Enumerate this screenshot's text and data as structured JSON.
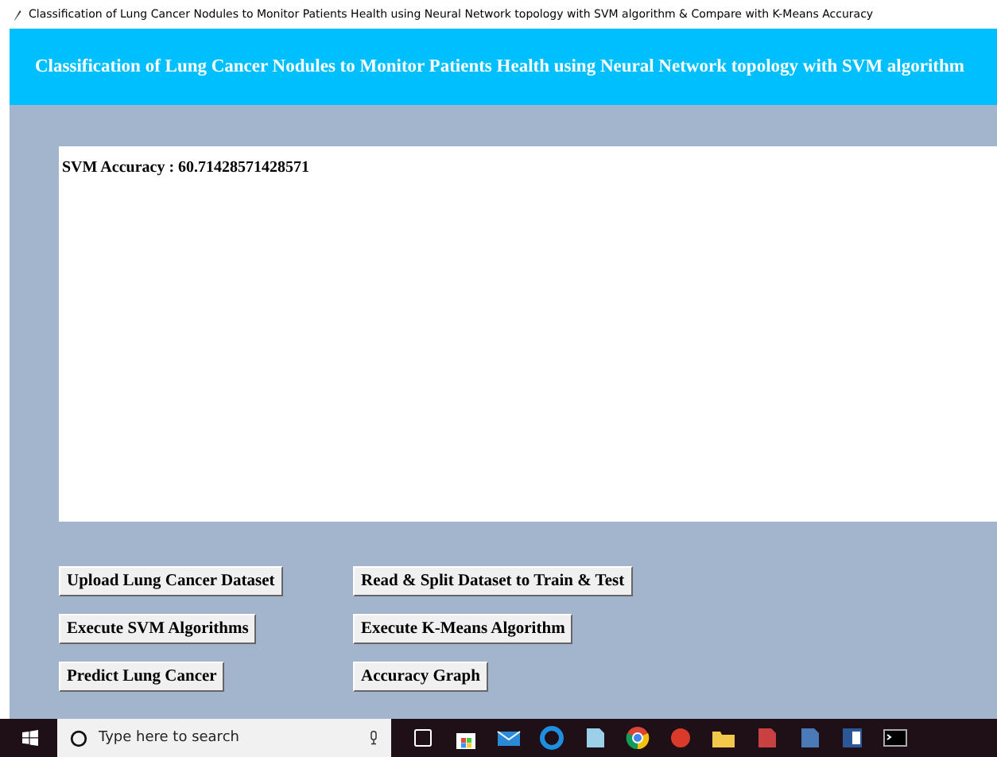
{
  "window": {
    "title": "Classification of Lung Cancer Nodules to Monitor Patients Health using Neural Network topology with SVM algorithm & Compare with K-Means Accuracy"
  },
  "header": {
    "title": "Classification of Lung Cancer Nodules to Monitor Patients Health using Neural Network topology with SVM algorithm"
  },
  "output": {
    "text": "SVM Accuracy : 60.71428571428571"
  },
  "buttons": [
    [
      "Upload Lung Cancer Dataset",
      "Read & Split Dataset to Train & Test"
    ],
    [
      "Execute SVM Algorithms",
      "Execute K-Means Algorithm"
    ],
    [
      "Predict Lung Cancer",
      "Accuracy Graph"
    ]
  ],
  "taskbar": {
    "search_placeholder": "Type here to search"
  }
}
